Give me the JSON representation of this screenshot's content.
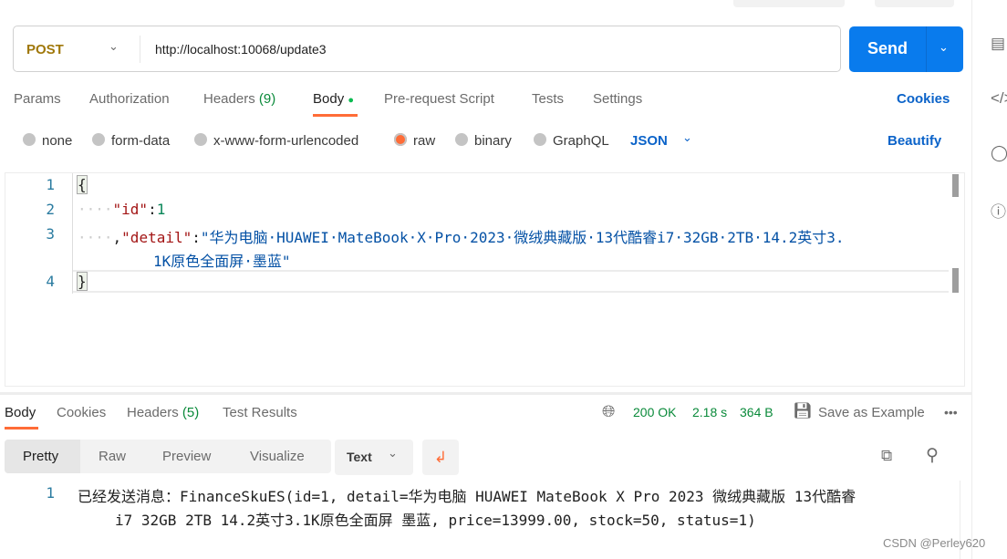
{
  "request": {
    "method": "POST",
    "url": "http://localhost:10068/update3",
    "send_label": "Send"
  },
  "req_tabs": [
    {
      "label": "Params"
    },
    {
      "label": "Authorization"
    },
    {
      "label": "Headers",
      "count": "(9)"
    },
    {
      "label": "Body"
    },
    {
      "label": "Pre-request Script"
    },
    {
      "label": "Tests"
    },
    {
      "label": "Settings"
    }
  ],
  "cookies_label": "Cookies",
  "body_types": [
    "none",
    "form-data",
    "x-www-form-urlencoded",
    "raw",
    "binary",
    "GraphQL"
  ],
  "selected_body_type": "raw",
  "format": "JSON",
  "beautify_label": "Beautify",
  "editor": {
    "line_numbers": [
      "1",
      "2",
      "3",
      "4"
    ],
    "l1": "{",
    "l2_key": "\"id\"",
    "l2_colon": ":",
    "l2_val": "1",
    "l3_pre": ",",
    "l3_key": "\"detail\"",
    "l3_colon": ":",
    "l3_val": "\"华为电脑·HUAWEI·MateBook·X·Pro·2023·微绒典藏版·13代酷睿i7·32GB·2TB·14.2英寸3.",
    "l3_cont": "1K原色全面屏·墨蓝\"",
    "l4": "}"
  },
  "resp_tabs": [
    {
      "label": "Body"
    },
    {
      "label": "Cookies"
    },
    {
      "label": "Headers",
      "count": "(5)"
    },
    {
      "label": "Test Results"
    }
  ],
  "status": {
    "code": "200 OK",
    "time": "2.18 s",
    "size": "364 B",
    "save_label": "Save as Example"
  },
  "view_modes": [
    "Pretty",
    "Raw",
    "Preview",
    "Visualize"
  ],
  "response_format": "Text",
  "response": {
    "line_number": "1",
    "line1": "已经发送消息：FinanceSkuES(id=1, detail=华为电脑 HUAWEI MateBook X Pro 2023 微绒典藏版 13代酷睿",
    "line2": "i7 32GB 2TB 14.2英寸3.1K原色全面屏 墨蓝, price=13999.00, stock=50, status=1)"
  },
  "watermark": "CSDN @Perley620",
  "colors": {
    "accent": "#ff6c37",
    "send": "#097bed",
    "link": "#0b63c9",
    "status_ok": "#0a8a3a"
  }
}
